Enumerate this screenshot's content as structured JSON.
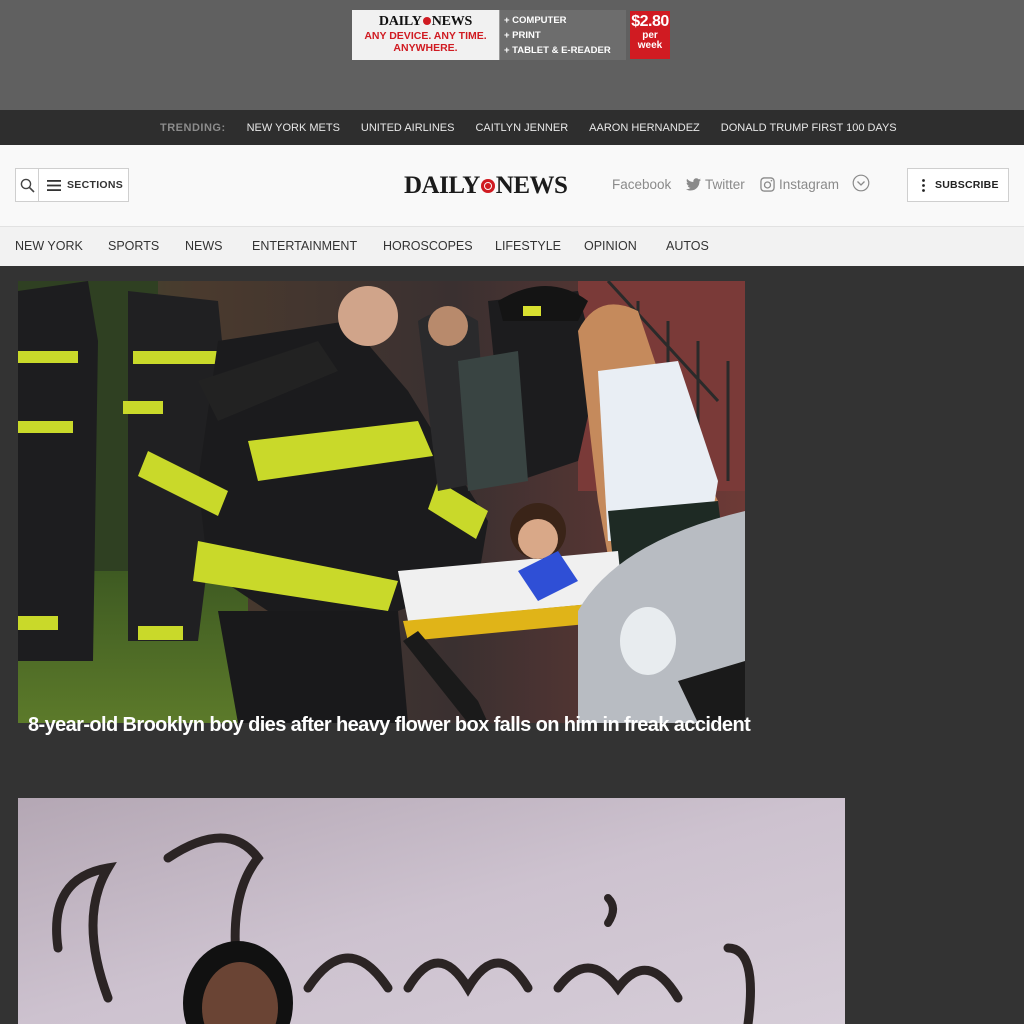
{
  "ad": {
    "logo_part1": "DAILY",
    "logo_part2": "NEWS",
    "tagline1": "ANY DEVICE. ANY TIME.",
    "tagline2": "ANYWHERE.",
    "features": [
      "+ COMPUTER",
      "+ PRINT",
      "+ TABLET & E-READER"
    ],
    "price": "$2.80",
    "price_unit1": "per",
    "price_unit2": "week",
    "price_color": "#d01b22"
  },
  "trending": {
    "label": "TRENDING:",
    "items": [
      "NEW YORK METS",
      "UNITED AIRLINES",
      "CAITLYN JENNER",
      "AARON HERNANDEZ",
      "DONALD TRUMP FIRST 100 DAYS"
    ]
  },
  "header": {
    "search_icon": "search-icon",
    "sections_label": "SECTIONS",
    "logo_part1": "DAILY",
    "logo_part2": "NEWS",
    "social": {
      "facebook": "Facebook",
      "twitter": "Twitter",
      "instagram": "Instagram"
    },
    "subscribe_label": "SUBSCRIBE",
    "accent_color": "#d01b22"
  },
  "nav": {
    "items": [
      "NEW YORK",
      "SPORTS",
      "NEWS",
      "ENTERTAINMENT",
      "HOROSCOPES",
      "LIFESTYLE",
      "OPINION",
      "AUTOS"
    ]
  },
  "stories": [
    {
      "headline": "8-year-old Brooklyn boy dies after heavy flower box falls on him in freak accident",
      "image": "photo: firefighters and paramedic tending to a boy on a stretcher"
    },
    {
      "headline": "",
      "image": "photo: woman in front of backdrop with script lettering"
    }
  ]
}
